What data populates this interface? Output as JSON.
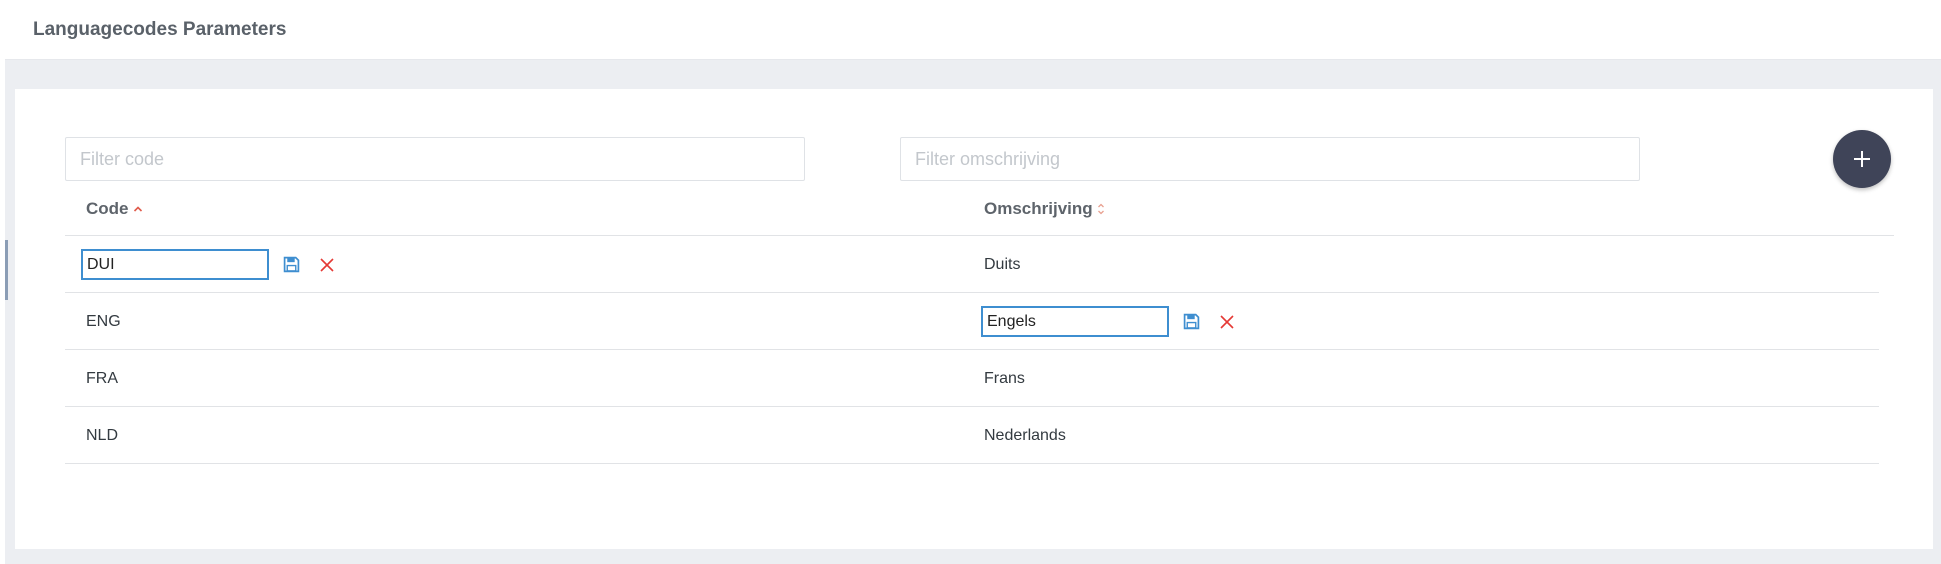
{
  "page": {
    "title": "Languagecodes Parameters"
  },
  "filters": {
    "code_placeholder": "Filter code",
    "description_placeholder": "Filter omschrijving"
  },
  "add_button": {
    "icon": "plus-icon"
  },
  "table": {
    "columns": [
      {
        "label": "Code",
        "sort": "ascending",
        "sort_icon": "sort-asc-icon"
      },
      {
        "label": "Omschrijving",
        "sort": "none",
        "sort_icon": "sort-both-icon"
      }
    ],
    "rows": [
      {
        "code": "DUI",
        "description": "Duits",
        "editing": "code"
      },
      {
        "code": "ENG",
        "description": "Engels",
        "editing": "description"
      },
      {
        "code": "FRA",
        "description": "Frans",
        "editing": "none"
      },
      {
        "code": "NLD",
        "description": "Nederlands",
        "editing": "none"
      }
    ]
  },
  "icons": {
    "save": "save-icon",
    "cancel": "cancel-icon"
  },
  "colors": {
    "accent_blue": "#3e8ed0",
    "cancel_red": "#e53935",
    "sort_active": "#e05a4a",
    "fab": "#3f4458"
  }
}
